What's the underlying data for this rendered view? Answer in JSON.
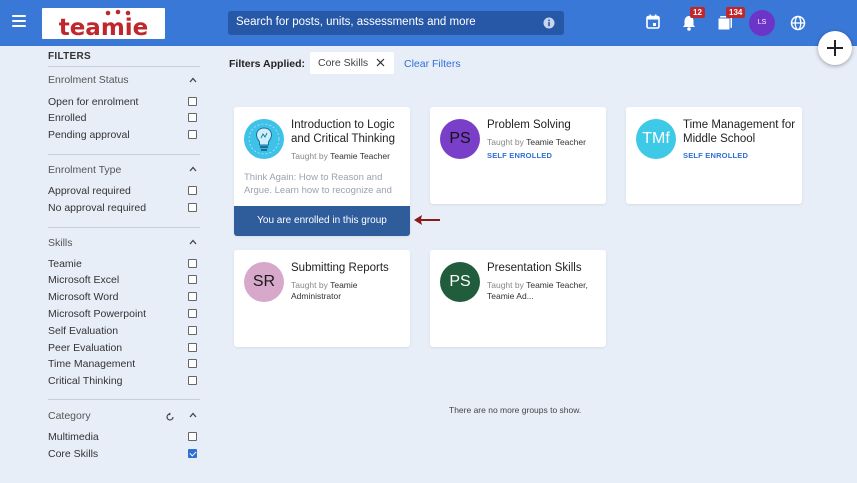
{
  "header": {
    "logo_text": "teamie",
    "search_placeholder": "Search for posts, units, assessments and more",
    "notifications_count": "12",
    "messages_count": "134",
    "avatar_initials": "LS"
  },
  "sidebar": {
    "title": "FILTERS",
    "sections": [
      {
        "label": "Enrolment Status",
        "options": [
          {
            "label": "Open for enrolment",
            "checked": false
          },
          {
            "label": "Enrolled",
            "checked": false
          },
          {
            "label": "Pending approval",
            "checked": false
          }
        ]
      },
      {
        "label": "Enrolment Type",
        "options": [
          {
            "label": "Approval required",
            "checked": false
          },
          {
            "label": "No approval required",
            "checked": false
          }
        ]
      },
      {
        "label": "Skills",
        "options": [
          {
            "label": "Teamie",
            "checked": false
          },
          {
            "label": "Microsoft Excel",
            "checked": false
          },
          {
            "label": "Microsoft Word",
            "checked": false
          },
          {
            "label": "Microsoft Powerpoint",
            "checked": false
          },
          {
            "label": "Self Evaluation",
            "checked": false
          },
          {
            "label": "Peer Evaluation",
            "checked": false
          },
          {
            "label": "Time Management",
            "checked": false
          },
          {
            "label": "Critical Thinking",
            "checked": false
          }
        ]
      },
      {
        "label": "Category",
        "options": [
          {
            "label": "Multimedia",
            "checked": false
          },
          {
            "label": "Core Skills",
            "checked": true
          }
        ]
      }
    ]
  },
  "filters_bar": {
    "label": "Filters Applied:",
    "chip": "Core Skills",
    "clear": "Clear Filters"
  },
  "cards": [
    {
      "title": "Introduction to Logic and Critical Thinking",
      "taught_prefix": "Taught by",
      "taught_by": "Teamie Teacher",
      "description": "Think Again: How to Reason and Argue. Learn how to recognize and",
      "enrolled_text": "You are enrolled in this group"
    },
    {
      "initials": "PS",
      "title": "Problem Solving",
      "taught_prefix": "Taught by",
      "taught_by": "Teamie Teacher",
      "tag": "SELF ENROLLED",
      "color": "#7a3fc8"
    },
    {
      "initials": "TMf",
      "title": "Time Management for Middle School",
      "tag": "SELF ENROLLED",
      "color": "#3ec9e6"
    },
    {
      "initials": "SR",
      "title": "Submitting Reports",
      "taught_prefix": "Taught by",
      "taught_by": "Teamie Administrator",
      "color": "#d7a8c9"
    },
    {
      "initials": "PS",
      "title": "Presentation Skills",
      "taught_prefix": "Taught by",
      "taught_by": "Teamie Teacher, Teamie Ad...",
      "color": "#215d3c"
    }
  ],
  "footer_message": "There are no more groups to show."
}
